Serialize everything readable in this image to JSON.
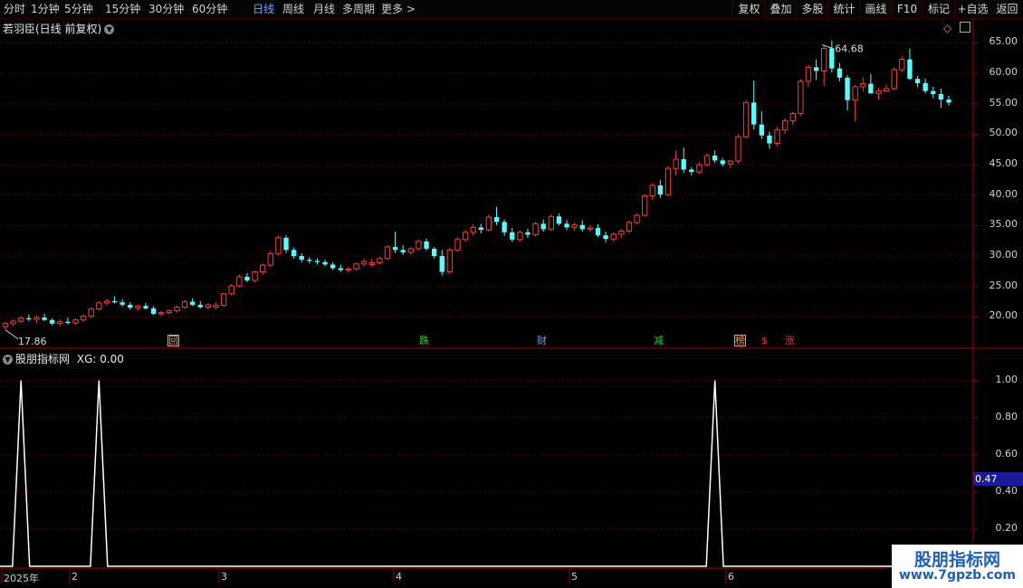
{
  "toolbar": {
    "periods": [
      "分时",
      "1分钟",
      "5分钟",
      "15分钟",
      "30分钟",
      "60分钟",
      "日线",
      "周线",
      "月线",
      "多周期",
      "更多 >"
    ],
    "active_index": 6,
    "right_buttons": [
      "复权",
      "叠加",
      "多股",
      "统计",
      "画线",
      "F10",
      "标记",
      "+自选",
      "返回"
    ]
  },
  "main_chart": {
    "title": "若羽臣(日线 前复权)",
    "high_label": "64.68",
    "low_label": "17.86",
    "y_ticks": [
      "65.00",
      "60.00",
      "55.00",
      "50.00",
      "45.00",
      "40.00",
      "35.00",
      "30.00",
      "25.00",
      "20.00"
    ],
    "events": [
      {
        "text": "回",
        "color": "#e0a060",
        "box": true
      },
      {
        "text": "跌",
        "color": "#30d030",
        "box": false
      },
      {
        "text": "财",
        "color": "#60a0ff",
        "box": false
      },
      {
        "text": "减",
        "color": "#30d030",
        "box": false
      },
      {
        "text": "榜",
        "color": "#e0a060",
        "box": true
      },
      {
        "text": "$",
        "color": "#ff3030",
        "box": false
      },
      {
        "text": "涨",
        "color": "#ff3030",
        "box": false
      }
    ]
  },
  "sub_chart": {
    "title": "股朋指标网",
    "xg_label": "XG: 0.00",
    "y_ticks": [
      "1.00",
      "0.80",
      "0.60",
      "0.40",
      "0.20"
    ],
    "cursor_value": "0.47"
  },
  "x_axis": [
    "2025年",
    "2",
    "3",
    "4",
    "5",
    "6"
  ],
  "watermark": {
    "line1": "股朋指标网",
    "line2": "www.7gpzb.com"
  },
  "colors": {
    "up": "#ff3a3a",
    "down": "#54ffff",
    "grid": "#5a0000",
    "line": "#ffffff",
    "axis": "#a00000",
    "active": "#5aa8ff"
  },
  "chart_data": [
    {
      "type": "candlestick",
      "title": "若羽臣(日线 前复权)",
      "ylim": [
        15,
        67
      ],
      "candles": [
        [
          18.4,
          19.2,
          17.86,
          18.9
        ],
        [
          18.9,
          19.6,
          18.5,
          19.3
        ],
        [
          19.3,
          20.1,
          19.0,
          19.8
        ],
        [
          19.8,
          20.4,
          19.3,
          19.6
        ],
        [
          19.6,
          20.2,
          19.0,
          19.9
        ],
        [
          19.9,
          20.5,
          19.3,
          19.5
        ],
        [
          19.5,
          19.8,
          18.6,
          18.9
        ],
        [
          18.9,
          19.6,
          18.5,
          19.2
        ],
        [
          19.2,
          19.9,
          18.8,
          19.0
        ],
        [
          19.0,
          19.8,
          18.7,
          19.5
        ],
        [
          19.5,
          20.4,
          19.2,
          20.1
        ],
        [
          20.1,
          21.6,
          19.8,
          21.3
        ],
        [
          21.3,
          22.6,
          21.0,
          22.3
        ],
        [
          22.3,
          23.0,
          21.8,
          22.6
        ],
        [
          22.6,
          23.4,
          22.2,
          22.4
        ],
        [
          22.4,
          22.9,
          21.7,
          22.0
        ],
        [
          22.0,
          22.4,
          21.2,
          21.5
        ],
        [
          21.5,
          22.0,
          21.0,
          21.8
        ],
        [
          21.8,
          22.3,
          21.2,
          21.4
        ],
        [
          21.4,
          21.8,
          20.3,
          20.5
        ],
        [
          20.5,
          21.0,
          20.2,
          20.7
        ],
        [
          20.7,
          21.2,
          20.4,
          21.0
        ],
        [
          21.0,
          21.9,
          20.7,
          21.6
        ],
        [
          21.6,
          22.8,
          21.3,
          22.5
        ],
        [
          22.5,
          23.1,
          21.8,
          22.0
        ],
        [
          22.0,
          22.6,
          21.4,
          21.6
        ],
        [
          21.6,
          22.3,
          21.2,
          22.0
        ],
        [
          21.6,
          22.4,
          21.3,
          21.9
        ],
        [
          21.9,
          24.0,
          21.6,
          23.8
        ],
        [
          23.8,
          25.4,
          23.5,
          25.1
        ],
        [
          25.1,
          27.0,
          24.8,
          26.6
        ],
        [
          26.6,
          27.2,
          25.7,
          26.0
        ],
        [
          26.0,
          27.6,
          25.6,
          27.4
        ],
        [
          27.4,
          28.8,
          26.9,
          28.5
        ],
        [
          28.5,
          30.8,
          28.2,
          30.4
        ],
        [
          30.4,
          33.4,
          30.1,
          33.0
        ],
        [
          33.0,
          33.4,
          30.5,
          31.0
        ],
        [
          31.0,
          31.4,
          29.6,
          30.0
        ],
        [
          30.0,
          30.5,
          28.9,
          29.4
        ],
        [
          29.4,
          29.8,
          28.8,
          29.2
        ],
        [
          29.2,
          29.6,
          28.6,
          29.0
        ],
        [
          29.0,
          29.4,
          28.3,
          28.6
        ],
        [
          28.6,
          29.0,
          27.7,
          28.0
        ],
        [
          28.0,
          28.6,
          27.4,
          27.7
        ],
        [
          27.7,
          28.2,
          27.3,
          27.9
        ],
        [
          27.9,
          28.9,
          27.6,
          28.7
        ],
        [
          28.7,
          29.6,
          28.3,
          29.1
        ],
        [
          28.6,
          29.6,
          28.2,
          28.9
        ],
        [
          28.9,
          29.9,
          28.6,
          29.6
        ],
        [
          29.6,
          31.8,
          29.3,
          31.5
        ],
        [
          31.5,
          34.0,
          30.5,
          31.0
        ],
        [
          31.0,
          31.8,
          30.2,
          30.6
        ],
        [
          30.6,
          31.5,
          30.2,
          31.2
        ],
        [
          31.2,
          32.7,
          30.9,
          32.4
        ],
        [
          32.4,
          32.9,
          30.9,
          31.2
        ],
        [
          31.2,
          31.5,
          29.6,
          30.0
        ],
        [
          30.0,
          31.0,
          26.8,
          27.4
        ],
        [
          27.4,
          31.4,
          27.1,
          31.0
        ],
        [
          31.0,
          33.1,
          30.7,
          32.7
        ],
        [
          32.7,
          34.3,
          32.4,
          33.9
        ],
        [
          33.9,
          35.2,
          33.4,
          34.7
        ],
        [
          34.7,
          35.3,
          33.7,
          34.3
        ],
        [
          34.3,
          36.8,
          34.0,
          36.4
        ],
        [
          36.4,
          38.1,
          35.1,
          35.6
        ],
        [
          35.6,
          36.0,
          33.3,
          33.9
        ],
        [
          33.9,
          34.6,
          32.3,
          32.7
        ],
        [
          32.7,
          34.2,
          32.4,
          33.9
        ],
        [
          33.9,
          34.5,
          33.0,
          33.5
        ],
        [
          33.5,
          35.6,
          33.2,
          35.3
        ],
        [
          35.3,
          36.0,
          34.0,
          34.4
        ],
        [
          34.4,
          36.8,
          34.1,
          36.5
        ],
        [
          36.5,
          37.0,
          35.0,
          35.3
        ],
        [
          35.3,
          35.9,
          34.3,
          34.7
        ],
        [
          34.7,
          35.5,
          34.2,
          35.1
        ],
        [
          35.1,
          35.9,
          34.0,
          34.4
        ],
        [
          34.4,
          35.1,
          33.9,
          34.6
        ],
        [
          34.6,
          35.2,
          33.1,
          33.4
        ],
        [
          33.4,
          34.0,
          32.2,
          32.8
        ],
        [
          32.8,
          33.9,
          32.4,
          33.6
        ],
        [
          33.6,
          34.4,
          33.0,
          34.1
        ],
        [
          34.1,
          35.8,
          33.8,
          35.5
        ],
        [
          35.5,
          37.0,
          35.2,
          36.7
        ],
        [
          36.7,
          40.2,
          36.4,
          39.9
        ],
        [
          39.9,
          42.0,
          39.2,
          41.6
        ],
        [
          41.6,
          42.5,
          39.5,
          40.1
        ],
        [
          40.1,
          44.8,
          39.8,
          44.4
        ],
        [
          44.4,
          47.3,
          43.2,
          45.9
        ],
        [
          45.9,
          47.8,
          43.6,
          44.2
        ],
        [
          44.2,
          44.6,
          43.2,
          43.8
        ],
        [
          43.8,
          45.4,
          43.5,
          45.0
        ],
        [
          45.0,
          46.9,
          44.7,
          46.5
        ],
        [
          46.5,
          47.4,
          45.3,
          45.7
        ],
        [
          45.7,
          46.1,
          44.7,
          45.1
        ],
        [
          45.1,
          45.8,
          44.4,
          45.6
        ],
        [
          45.6,
          50.0,
          45.2,
          49.6
        ],
        [
          49.6,
          55.6,
          49.3,
          55.2
        ],
        [
          55.2,
          58.8,
          50.8,
          51.6
        ],
        [
          51.6,
          53.8,
          49.2,
          49.8
        ],
        [
          49.8,
          50.4,
          47.6,
          48.5
        ],
        [
          48.5,
          51.2,
          48.1,
          50.7
        ],
        [
          50.7,
          52.6,
          50.1,
          52.2
        ],
        [
          52.2,
          53.7,
          51.5,
          53.4
        ],
        [
          53.4,
          59.1,
          53.0,
          58.7
        ],
        [
          58.7,
          61.4,
          57.7,
          61.0
        ],
        [
          61.0,
          62.3,
          58.9,
          60.4
        ],
        [
          60.4,
          64.68,
          57.9,
          64.1
        ],
        [
          64.1,
          65.4,
          60.1,
          60.8
        ],
        [
          60.8,
          61.7,
          58.7,
          59.3
        ],
        [
          59.3,
          59.7,
          53.9,
          55.6
        ],
        [
          55.6,
          58.1,
          52.1,
          57.8
        ],
        [
          57.8,
          59.4,
          57.0,
          58.3
        ],
        [
          58.3,
          59.9,
          57.2,
          56.7
        ],
        [
          56.7,
          57.6,
          55.7,
          57.1
        ],
        [
          57.1,
          58.2,
          56.9,
          57.5
        ],
        [
          57.5,
          61.0,
          57.2,
          60.6
        ],
        [
          60.6,
          62.8,
          60.2,
          62.3
        ],
        [
          62.3,
          64.1,
          58.9,
          59.1
        ],
        [
          59.1,
          59.6,
          57.7,
          58.4
        ],
        [
          58.4,
          59.1,
          56.7,
          57.1
        ],
        [
          57.1,
          57.8,
          55.9,
          56.6
        ],
        [
          56.6,
          57.5,
          54.3,
          55.7
        ],
        [
          55.7,
          56.3,
          54.7,
          55.2
        ]
      ]
    },
    {
      "type": "line",
      "title": "股朋指标网",
      "ylim": [
        0,
        1.1
      ],
      "spikes_at_candle_index": [
        2,
        12,
        91
      ],
      "baseline": 0,
      "peak": 1.0
    }
  ]
}
